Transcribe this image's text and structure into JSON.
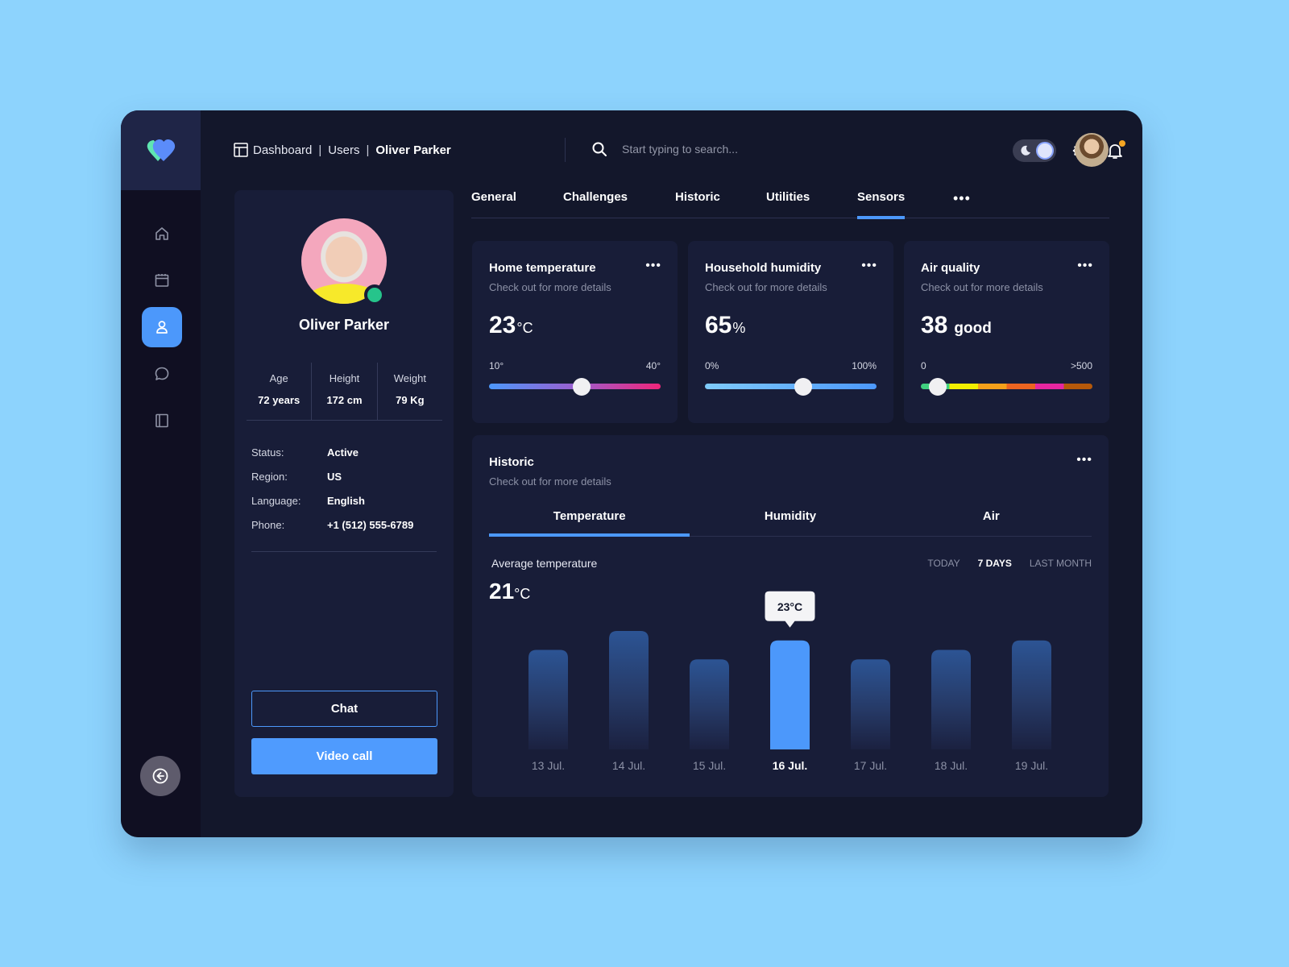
{
  "app": {
    "logo": "heart-logo"
  },
  "breadcrumb": {
    "items": [
      "Dashboard",
      "Users"
    ],
    "current": "Oliver Parker",
    "icon": "layout-icon"
  },
  "search": {
    "placeholder": "Start typing to search...",
    "value": ""
  },
  "header": {
    "theme_toggle": "dark",
    "icons": [
      "moon-icon",
      "gear-icon",
      "bell-icon"
    ],
    "has_notification": true
  },
  "sidebar": {
    "items": [
      {
        "name": "home",
        "icon": "home-icon",
        "active": false
      },
      {
        "name": "calendar",
        "icon": "calendar-icon",
        "active": false
      },
      {
        "name": "users",
        "icon": "user-icon",
        "active": true
      },
      {
        "name": "messages",
        "icon": "chat-icon",
        "active": false
      },
      {
        "name": "book",
        "icon": "book-icon",
        "active": false
      }
    ],
    "back_icon": "arrow-left-circle-icon"
  },
  "profile": {
    "name": "Oliver Parker",
    "online": true,
    "stats": [
      {
        "label": "Age",
        "value": "72 years"
      },
      {
        "label": "Height",
        "value": "172 cm"
      },
      {
        "label": "Weight",
        "value": "79 Kg"
      }
    ],
    "info": [
      {
        "key": "Status:",
        "value": "Active"
      },
      {
        "key": "Region:",
        "value": "US"
      },
      {
        "key": "Language:",
        "value": "English"
      },
      {
        "key": "Phone:",
        "value": "+1 (512) 555-6789"
      }
    ],
    "chat_label": "Chat",
    "video_label": "Video call"
  },
  "tabs": {
    "items": [
      "General",
      "Challenges",
      "Historic",
      "Utilities",
      "Sensors"
    ],
    "active": "Sensors",
    "more": "•••"
  },
  "cards": [
    {
      "title": "Home temperature",
      "subtitle": "Check out for more details",
      "value": "23",
      "unit": "°C",
      "min": "10°",
      "max": "40°",
      "slider_fraction": 0.54,
      "dots": "•••"
    },
    {
      "title": "Household humidity",
      "subtitle": "Check out for more details",
      "value": "65",
      "unit": "%",
      "min": "0%",
      "max": "100%",
      "slider_fraction": 0.575,
      "dots": "•••"
    },
    {
      "title": "Air quality",
      "subtitle": "Check out for more details",
      "value": "38",
      "unit": "good",
      "min": "0",
      "max": ">500",
      "slider_fraction": 0.1,
      "dots": "•••"
    }
  ],
  "colors": {
    "accent": "#4c98fb",
    "online": "#26c48b",
    "notification": "#f5a623",
    "air_scale": [
      "#3fd07f",
      "#f2ef00",
      "#f5a01a",
      "#ec6420",
      "#e626a0",
      "#b5580a"
    ]
  },
  "historic": {
    "title": "Historic",
    "subtitle": "Check out for more details",
    "dots": "•••",
    "tabs": [
      "Temperature",
      "Humidity",
      "Air"
    ],
    "active_tab": "Temperature",
    "avg_label": "Average temperature",
    "avg_value": "21",
    "avg_unit": "°C",
    "ranges": [
      "TODAY",
      "7 DAYS",
      "LAST MONTH"
    ],
    "active_range": "7 DAYS"
  },
  "chart_data": {
    "type": "bar",
    "title": "Average temperature",
    "categories": [
      "13 Jul.",
      "14 Jul.",
      "15 Jul.",
      "16 Jul.",
      "17 Jul.",
      "18 Jul.",
      "19 Jul."
    ],
    "values": [
      21,
      25,
      19,
      23,
      19,
      21,
      23
    ],
    "unit": "°C",
    "highlighted_index": 3,
    "tooltip": "23°C",
    "xlabel": "",
    "ylabel": "",
    "ylim": [
      0,
      25
    ],
    "grid": false
  }
}
